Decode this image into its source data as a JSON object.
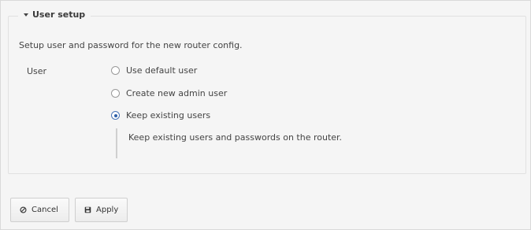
{
  "section": {
    "title": "User setup",
    "collapse_icon": "caret-down-icon",
    "description": "Setup user and password for the new router config."
  },
  "user_field": {
    "label": "User",
    "options": [
      {
        "label": "Use default user",
        "selected": false
      },
      {
        "label": "Create new admin user",
        "selected": false
      },
      {
        "label": "Keep existing users",
        "selected": true
      }
    ],
    "help_text": "Keep existing users and passwords on the router."
  },
  "actions": {
    "cancel_label": "Cancel",
    "cancel_icon": "cancel-icon",
    "apply_label": "Apply",
    "apply_icon": "save-icon"
  },
  "colors": {
    "selected_radio": "#2e5fa7",
    "background": "#f5f5f5"
  }
}
